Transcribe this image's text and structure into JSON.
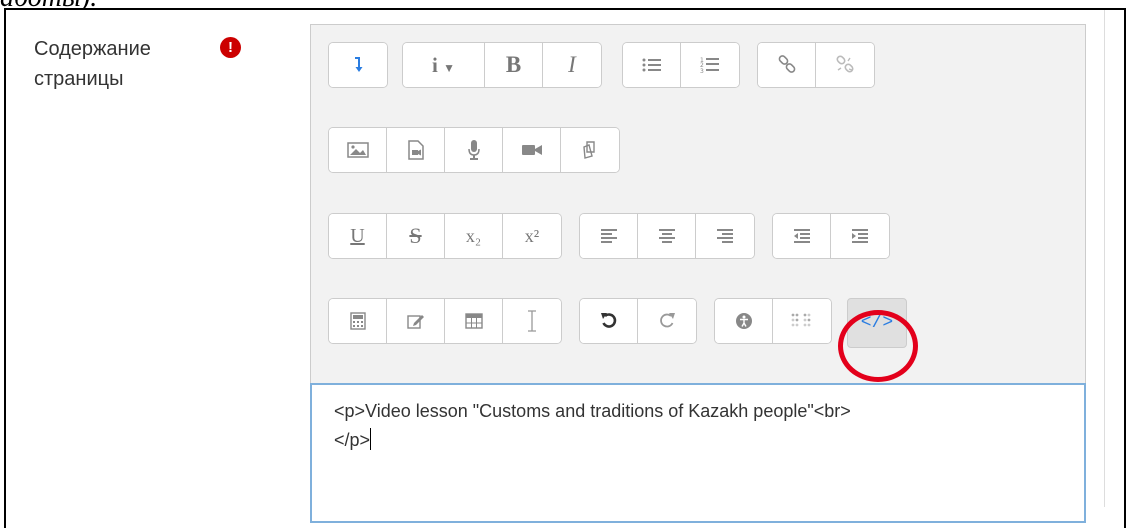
{
  "top_fragment": "аботы).",
  "field": {
    "label_line1": "Содержание",
    "label_line2": "страницы",
    "required_icon": "exclamation-circle-icon",
    "required_color": "#cc0000"
  },
  "toolbar": {
    "row1": [
      {
        "name": "collapse-toolbar-button",
        "icon": "collapse-arrow-icon",
        "label": "↴"
      },
      {
        "name": "paragraph-styles-button",
        "icon": "info-dropdown-icon",
        "label": "i ▾"
      },
      {
        "name": "bold-button",
        "label": "B"
      },
      {
        "name": "italic-button",
        "label": "I"
      },
      {
        "name": "unordered-list-button",
        "icon": "bulleted-list-icon"
      },
      {
        "name": "ordered-list-button",
        "icon": "numbered-list-icon"
      },
      {
        "name": "link-button",
        "icon": "link-icon"
      },
      {
        "name": "unlink-button",
        "icon": "unlink-icon"
      }
    ],
    "row2": [
      {
        "name": "insert-image-button",
        "icon": "image-icon"
      },
      {
        "name": "insert-media-button",
        "icon": "media-file-icon"
      },
      {
        "name": "record-audio-button",
        "icon": "microphone-icon"
      },
      {
        "name": "record-video-button",
        "icon": "video-camera-icon"
      },
      {
        "name": "manage-files-button",
        "icon": "copy-files-icon"
      }
    ],
    "row3": [
      {
        "name": "underline-button",
        "label": "U"
      },
      {
        "name": "strikethrough-button",
        "label": "S"
      },
      {
        "name": "subscript-button",
        "label": "x₂"
      },
      {
        "name": "superscript-button",
        "label": "x²"
      },
      {
        "name": "align-left-button",
        "icon": "align-left-icon"
      },
      {
        "name": "align-center-button",
        "icon": "align-center-icon"
      },
      {
        "name": "align-right-button",
        "icon": "align-right-icon"
      },
      {
        "name": "outdent-button",
        "icon": "outdent-icon"
      },
      {
        "name": "indent-button",
        "icon": "indent-icon"
      }
    ],
    "row4": [
      {
        "name": "equation-button",
        "icon": "calculator-icon"
      },
      {
        "name": "special-char-button",
        "icon": "edit-pencil-icon"
      },
      {
        "name": "table-button",
        "icon": "table-icon"
      },
      {
        "name": "clear-formatting-button",
        "icon": "text-cursor-icon"
      },
      {
        "name": "undo-button",
        "icon": "undo-icon"
      },
      {
        "name": "redo-button",
        "icon": "redo-icon"
      },
      {
        "name": "accessibility-checker-button",
        "icon": "accessibility-icon"
      },
      {
        "name": "screenreader-helper-button",
        "icon": "braille-dots-icon"
      },
      {
        "name": "html-source-button",
        "icon": "code-brackets-icon",
        "label": "</>"
      }
    ],
    "highlight_color": "#e3001b",
    "accent_color": "#2a7de1"
  },
  "content": {
    "line1": "<p>Video lesson \"Customs and traditions of Kazakh people\"<br>",
    "line2": "</p>"
  }
}
